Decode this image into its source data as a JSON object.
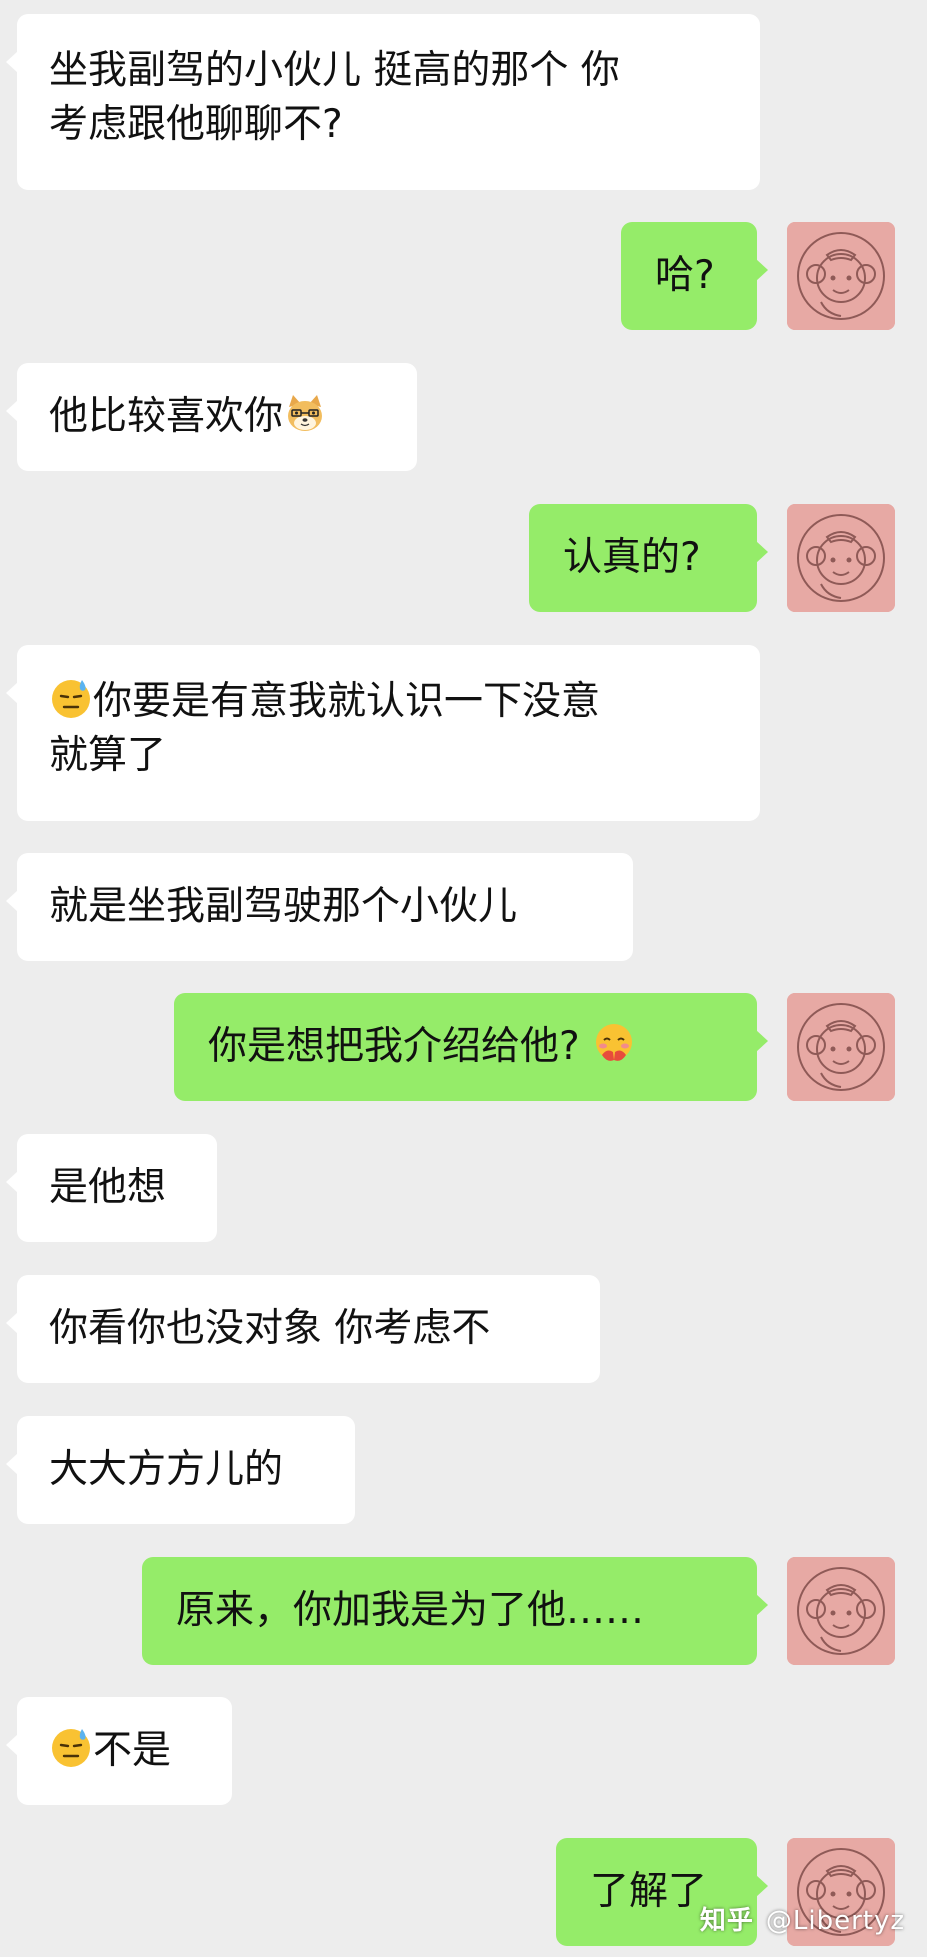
{
  "messages": [
    {
      "side": "left",
      "text_line1": " 坐我副驾的小伙儿 挺高的那个 你",
      "text_line2": "考虑跟他聊聊不?"
    },
    {
      "side": "right",
      "text": "哈?"
    },
    {
      "side": "left",
      "text": "他比较喜欢你",
      "emoji": "doge-icon"
    },
    {
      "side": "right",
      "text": "认真的?"
    },
    {
      "side": "left",
      "emoji": "sweat-icon",
      "text_line1": "你要是有意我就认识一下没意",
      "text_line2": "就算了"
    },
    {
      "side": "left",
      "text": "就是坐我副驾驶那个小伙儿"
    },
    {
      "side": "right",
      "text": "你是想把我介绍给他?",
      "emoji": "blush-hands-icon"
    },
    {
      "side": "left",
      "text": "是他想"
    },
    {
      "side": "left",
      "text": "你看你也没对象 你考虑不"
    },
    {
      "side": "left",
      "text": "大大方方儿的"
    },
    {
      "side": "right",
      "text": "原来，你加我是为了他……"
    },
    {
      "side": "left",
      "emoji": "sweat-icon",
      "text": "不是"
    },
    {
      "side": "right",
      "text": "了解了"
    }
  ],
  "watermark": {
    "logo": "知乎",
    "user": "@Libertyz"
  },
  "colors": {
    "background": "#ededed",
    "left_bubble": "#ffffff",
    "right_bubble": "#95ec69",
    "avatar_bg": "#e7a9a4"
  }
}
